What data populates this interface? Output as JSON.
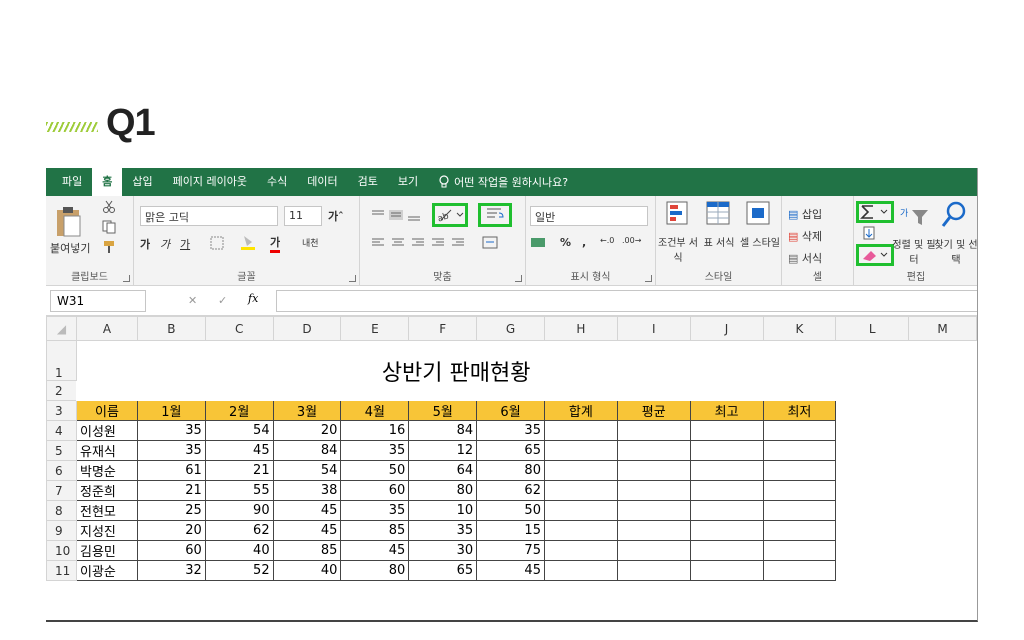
{
  "heading": {
    "label": "Q1"
  },
  "menu": {
    "tabs": [
      "파일",
      "홈",
      "삽입",
      "페이지 레이아웃",
      "수식",
      "데이터",
      "검토",
      "보기"
    ],
    "tell_me": "어떤 작업을 원하시나요?"
  },
  "ribbon": {
    "clipboard": {
      "paste": "붙여넣기",
      "label": "클립보드"
    },
    "font": {
      "name": "맑은 고딕",
      "size": "11",
      "bold": "가",
      "italic": "가",
      "underline": "가",
      "color_letter": "가",
      "label": "글꼴"
    },
    "alignment": {
      "label": "맞춤"
    },
    "number": {
      "format": "일반",
      "percent": "%",
      "comma": ",",
      "label": "표시 형식"
    },
    "styles": {
      "cond_format": "조건부 서식",
      "table_format": "표 서식",
      "cell_styles": "셀 스타일",
      "label": "스타일"
    },
    "cells": {
      "insert": "삽입",
      "delete": "삭제",
      "format": "서식",
      "label": "셀"
    },
    "editing": {
      "sort_filter": "정렬 및 필터",
      "find_select": "찾기 및 선택",
      "label": "편집"
    }
  },
  "formula_bar": {
    "cell": "W31",
    "fx": "fx",
    "content": ""
  },
  "sheet": {
    "columns": [
      "A",
      "B",
      "C",
      "D",
      "E",
      "F",
      "G",
      "H",
      "I",
      "J",
      "K",
      "L",
      "M"
    ],
    "title": "상반기 판매현황",
    "headers": [
      "이름",
      "1월",
      "2월",
      "3월",
      "4월",
      "5월",
      "6월",
      "합계",
      "평균",
      "최고",
      "최저"
    ],
    "rows": [
      {
        "num": "4",
        "name": "이성원",
        "values": [
          "35",
          "54",
          "20",
          "16",
          "84",
          "35"
        ]
      },
      {
        "num": "5",
        "name": "유재식",
        "values": [
          "35",
          "45",
          "84",
          "35",
          "12",
          "65"
        ]
      },
      {
        "num": "6",
        "name": "박명순",
        "values": [
          "61",
          "21",
          "54",
          "50",
          "64",
          "80"
        ]
      },
      {
        "num": "7",
        "name": "정준희",
        "values": [
          "21",
          "55",
          "38",
          "60",
          "80",
          "62"
        ]
      },
      {
        "num": "8",
        "name": "전현모",
        "values": [
          "25",
          "90",
          "45",
          "35",
          "10",
          "50"
        ]
      },
      {
        "num": "9",
        "name": "지성진",
        "values": [
          "20",
          "62",
          "45",
          "85",
          "35",
          "15"
        ]
      },
      {
        "num": "10",
        "name": "김용민",
        "values": [
          "60",
          "40",
          "85",
          "45",
          "30",
          "75"
        ]
      },
      {
        "num": "11",
        "name": "이광순",
        "values": [
          "32",
          "52",
          "40",
          "80",
          "65",
          "45"
        ]
      }
    ]
  }
}
